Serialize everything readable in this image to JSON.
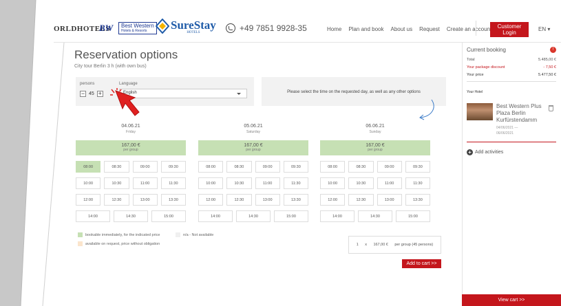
{
  "header": {
    "logo_worldhotels": "ORLDHOTELS",
    "logo_bw": "BW",
    "logo_bestwestern": "Best Western",
    "logo_bestwestern_sub": "Hotels & Resorts",
    "logo_surestay": "SureStay",
    "logo_surestay_sub": "HOTELS",
    "phone": "+49 7851 9928-35",
    "nav": [
      "Home",
      "Plan and book",
      "About us",
      "Request",
      "Create an account"
    ],
    "login_label": "Customer Login",
    "language": "EN ▾"
  },
  "main": {
    "title": "Reservation options",
    "subtitle": "City tour Berlin 3 h (with own bus)",
    "persons_label": "persons",
    "persons_value": "45",
    "language_label": "Language",
    "language_value": "English",
    "info_text": "Please select the time on the requested day, as well as any other options"
  },
  "days": [
    {
      "date": "04.06.21",
      "weekday": "Friday",
      "price": "167,00 €",
      "per": "per group",
      "slots": [
        "08:00",
        "08:30",
        "09:00",
        "09:30",
        "10:00",
        "10:30",
        "11:00",
        "11:30",
        "12:00",
        "12:30",
        "13:00",
        "13:30"
      ],
      "last_slots": [
        "14:00",
        "14:30",
        "15:00"
      ],
      "selected": "08:00"
    },
    {
      "date": "05.06.21",
      "weekday": "Saturday",
      "price": "167,00 €",
      "per": "per group",
      "slots": [
        "08:00",
        "08:30",
        "09:00",
        "09:30",
        "10:00",
        "10:30",
        "11:00",
        "11:30",
        "12:00",
        "12:30",
        "13:00",
        "13:30"
      ],
      "last_slots": [
        "14:00",
        "14:30",
        "15:00"
      ],
      "selected": ""
    },
    {
      "date": "06.06.21",
      "weekday": "Sunday",
      "price": "167,00 €",
      "per": "per group",
      "slots": [
        "08:00",
        "08:30",
        "09:00",
        "09:30",
        "10:00",
        "10:30",
        "11:00",
        "11:30",
        "12:00",
        "12:30",
        "13:00",
        "13:30"
      ],
      "last_slots": [
        "14:00",
        "14:30",
        "15:00"
      ],
      "selected": ""
    }
  ],
  "legend": {
    "bookable": "bookable immediately, for the indicated price",
    "na": "n/a - Not available",
    "on_request": "available on request, price without obligation"
  },
  "cart_line": {
    "qty": "1",
    "x": "x",
    "price": "167,00 €",
    "per": "per group (45 persons)"
  },
  "add_to_cart": "Add to cart  >>",
  "panel": {
    "title": "Current booking",
    "badge": "!",
    "total_label": "Total",
    "total_value": "5.485,00 €",
    "discount_label": "Your package discount",
    "discount_value": "- 7,50 €",
    "price_label": "Your price",
    "price_value": "5.477,50 €",
    "your_hotel": "Your Hotel",
    "hotel_name": "Best Western Plus Plaza Berlin Kurfürstendamm",
    "hotel_from": "04/06/2021 —",
    "hotel_to": "06/06/2021",
    "add_activities": "Add activities",
    "view_cart": "View cart  >>"
  },
  "colors": {
    "brand_red": "#c4161c",
    "bookable_green": "#c6e0b4",
    "on_request": "#fbe5cc",
    "not_available": "#f0f0f0"
  }
}
